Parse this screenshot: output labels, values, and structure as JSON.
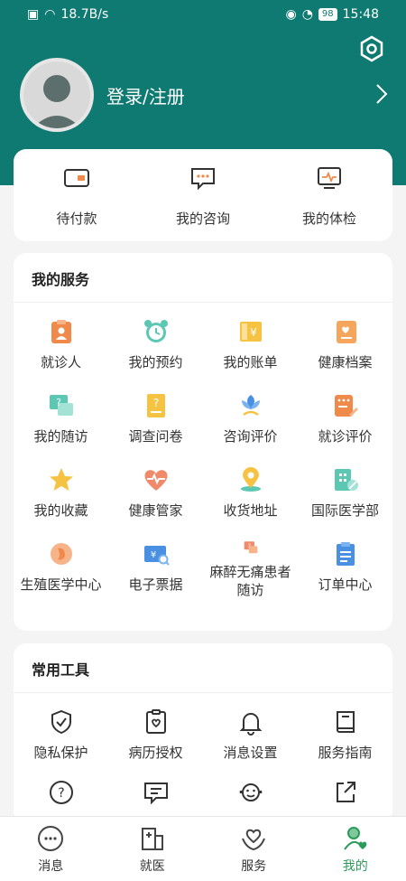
{
  "status": {
    "speed": "18.7B/s",
    "battery": "98",
    "time": "15:48"
  },
  "header": {
    "login_label": "登录/注册"
  },
  "quick_actions": [
    {
      "label": "待付款",
      "icon": "wallet-icon"
    },
    {
      "label": "我的咨询",
      "icon": "chat-bubble-icon"
    },
    {
      "label": "我的体检",
      "icon": "monitor-icon"
    }
  ],
  "services": {
    "title": "我的服务",
    "items": [
      {
        "label": "就诊人",
        "icon": "patient-card-icon"
      },
      {
        "label": "我的预约",
        "icon": "alarm-clock-icon"
      },
      {
        "label": "我的账单",
        "icon": "bill-icon"
      },
      {
        "label": "健康档案",
        "icon": "health-record-icon"
      },
      {
        "label": "我的随访",
        "icon": "followup-chat-icon"
      },
      {
        "label": "调查问卷",
        "icon": "questionnaire-icon"
      },
      {
        "label": "咨询评价",
        "icon": "flower-icon"
      },
      {
        "label": "就诊评价",
        "icon": "edit-note-icon"
      },
      {
        "label": "我的收藏",
        "icon": "star-icon"
      },
      {
        "label": "健康管家",
        "icon": "heart-pulse-icon"
      },
      {
        "label": "收货地址",
        "icon": "location-pin-icon"
      },
      {
        "label": "国际医学部",
        "icon": "hospital-icon"
      },
      {
        "label": "生殖医学中心",
        "icon": "embryo-icon"
      },
      {
        "label": "电子票据",
        "icon": "e-ticket-icon"
      },
      {
        "label": "麻醉无痛患者随访",
        "icon": "anesthesia-chat-icon"
      },
      {
        "label": "订单中心",
        "icon": "clipboard-icon"
      }
    ]
  },
  "tools": {
    "title": "常用工具",
    "items": [
      {
        "label": "隐私保护",
        "icon": "shield-check-icon"
      },
      {
        "label": "病历授权",
        "icon": "record-heart-icon"
      },
      {
        "label": "消息设置",
        "icon": "bell-icon"
      },
      {
        "label": "服务指南",
        "icon": "book-icon"
      },
      {
        "label": "",
        "icon": "help-circle-icon"
      },
      {
        "label": "",
        "icon": "feedback-icon"
      },
      {
        "label": "",
        "icon": "customer-service-icon"
      },
      {
        "label": "",
        "icon": "share-icon"
      }
    ]
  },
  "tabbar": [
    {
      "label": "消息",
      "icon": "message-dots-icon"
    },
    {
      "label": "就医",
      "icon": "hospital-building-icon"
    },
    {
      "label": "服务",
      "icon": "hands-heart-icon"
    },
    {
      "label": "我的",
      "icon": "user-heart-icon"
    }
  ],
  "colors": {
    "primary": "#0f7a72",
    "active_tab": "#2a9b59",
    "orange": "#f08a4b",
    "teal": "#5cc7b3",
    "yellow": "#f5c242",
    "blue": "#4a90e2"
  }
}
